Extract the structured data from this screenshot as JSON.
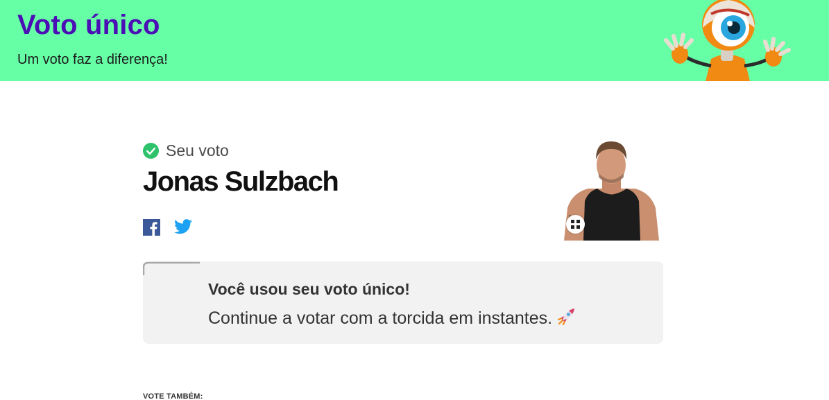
{
  "header": {
    "title": "Voto único",
    "subtitle": "Um voto faz a diferença!",
    "mascot_icon": "big-brother-eye-mascot",
    "background_color": "#66ffa6",
    "title_color": "#4b0fb5"
  },
  "vote": {
    "label": "Seu voto",
    "status_icon": "check-circle-icon",
    "status_color": "#2dc26b",
    "participant_name": "Jonas Sulzbach",
    "share": {
      "facebook_icon": "facebook-icon",
      "twitter_icon": "twitter-icon"
    },
    "photo_icon": "participant-photo",
    "expand_icon": "expand-icon"
  },
  "notice": {
    "title": "Você usou seu voto único!",
    "body": "Continue a votar com a torcida em instantes.",
    "icon": "rocket-icon"
  },
  "footer": {
    "vote_also": "VOTE TAMBÉM:"
  }
}
